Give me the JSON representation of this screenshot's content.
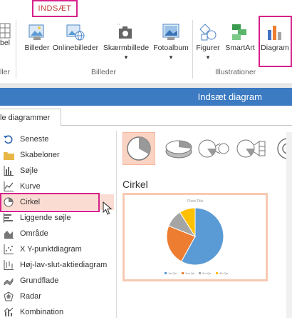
{
  "ribbon": {
    "active_tab": "INDSÆT",
    "buttons": {
      "partial_left": "bel",
      "billeder": "Billeder",
      "onlinebilleder": "Onlinebilleder",
      "skaermbillede": "Skærmbillede",
      "fotoalbum": "Fotoalbum",
      "figurer": "Figurer",
      "smartart": "SmartArt",
      "diagram": "Diagram"
    },
    "groups": {
      "partial_left": "ller",
      "billeder": "Billeder",
      "illustrationer": "Illustrationer"
    },
    "dropdown_glyph": "▾"
  },
  "dialog": {
    "title": "Indsæt diagram",
    "tab_label": "le diagrammer",
    "categories": [
      {
        "label": "Seneste",
        "icon": "recent-icon"
      },
      {
        "label": "Skabeloner",
        "icon": "folder-icon"
      },
      {
        "label": "Søjle",
        "icon": "column-chart-icon"
      },
      {
        "label": "Kurve",
        "icon": "line-chart-icon"
      },
      {
        "label": "Cirkel",
        "icon": "pie-chart-icon",
        "selected": true
      },
      {
        "label": "Liggende søjle",
        "icon": "bar-chart-icon"
      },
      {
        "label": "Område",
        "icon": "area-chart-icon"
      },
      {
        "label": "X Y-punktdiagram",
        "icon": "scatter-chart-icon"
      },
      {
        "label": "Høj-lav-slut-aktiediagram",
        "icon": "stock-chart-icon"
      },
      {
        "label": "Grundflade",
        "icon": "surface-chart-icon"
      },
      {
        "label": "Radar",
        "icon": "radar-chart-icon"
      },
      {
        "label": "Kombination",
        "icon": "combo-chart-icon"
      }
    ],
    "subtype_heading": "Cirkel",
    "preview": {
      "chart_title": "Chart Title",
      "legend": [
        "1st Qtr",
        "2nd Qtr",
        "3rd Qtr",
        "4th Qtr"
      ]
    },
    "colors": {
      "title_bar": "#3c7ac2",
      "highlight": "#d6218a",
      "selection": "#fbdcd2"
    }
  },
  "chart_data": {
    "type": "pie",
    "title": "Chart Title",
    "categories": [
      "1st Qtr",
      "2nd Qtr",
      "3rd Qtr",
      "4th Qtr"
    ],
    "values": [
      58,
      23,
      10,
      9
    ],
    "colors": [
      "#5b9bd5",
      "#ed7d31",
      "#a5a5a5",
      "#ffc000"
    ]
  }
}
